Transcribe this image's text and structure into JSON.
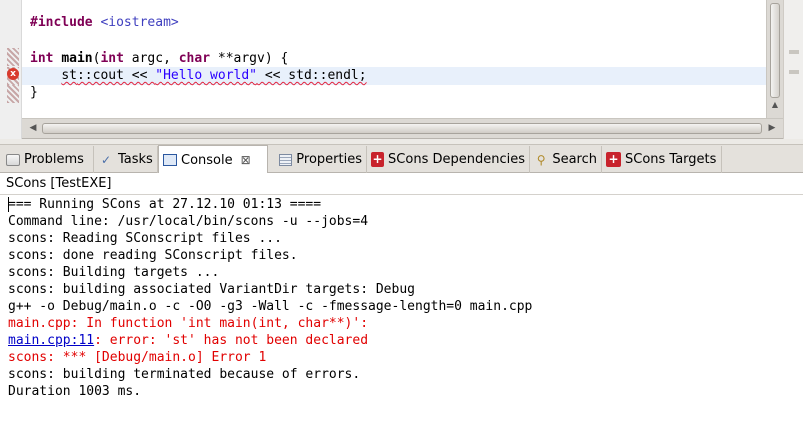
{
  "editor": {
    "lines": {
      "l1_kw": "#include",
      "l1_inc": "<iostream>",
      "l3_int": "int",
      "l3_main": "main",
      "l3_paren": "(",
      "l3_int2": "int",
      "l3_argc": " argc, ",
      "l3_char": "char",
      "l3_rest": " **argv) {",
      "l4_st": "st",
      "l4_mid": "::cout << ",
      "l4_str": "\"Hello world\"",
      "l4_end": " << std::endl;",
      "l5": "}"
    },
    "error_marker": "x"
  },
  "tabs": [
    {
      "label": "Problems",
      "icon": "problems-icon"
    },
    {
      "label": "Tasks",
      "icon": "tasks-icon"
    },
    {
      "label": "Console",
      "icon": "console-icon",
      "active": true
    },
    {
      "label": "Properties",
      "icon": "properties-icon"
    },
    {
      "label": "SCons Dependencies",
      "icon": "scons-icon"
    },
    {
      "label": "Search",
      "icon": "search-icon"
    },
    {
      "label": "SCons Targets",
      "icon": "scons-icon"
    }
  ],
  "glyphs": {
    "close": "⊠",
    "scons": "+",
    "tasks": "✓",
    "search": "⚲",
    "up": "▲",
    "left": "◀",
    "right": "▶"
  },
  "console": {
    "title": "SCons [TestEXE]",
    "lines": [
      {
        "text": "=== Running SCons at 27.12.10 01:13 ===="
      },
      {
        "text": "Command line: /usr/local/bin/scons -u --jobs=4"
      },
      {
        "text": "scons: Reading SConscript files ..."
      },
      {
        "text": "scons: done reading SConscript files."
      },
      {
        "text": "scons: Building targets ..."
      },
      {
        "text": "scons: building associated VariantDir targets: Debug"
      },
      {
        "text": "g++ -o Debug/main.o -c -O0 -g3 -Wall -c -fmessage-length=0 main.cpp"
      },
      {
        "text": "main.cpp: In function 'int main(int, char**)':"
      },
      {
        "link": "main.cpp:11",
        "text": ": error: 'st' has not been declared"
      },
      {
        "text": "scons: *** [Debug/main.o] Error 1"
      },
      {
        "text": "scons: building terminated because of errors."
      },
      {
        "text": "Duration 1003 ms."
      }
    ]
  },
  "colors": {
    "keyword": "#7f0055",
    "string": "#2a00ff",
    "include": "#3f3fbf",
    "error": "#e10000",
    "link": "#0000c8",
    "current_line": "#e8f0fb"
  }
}
